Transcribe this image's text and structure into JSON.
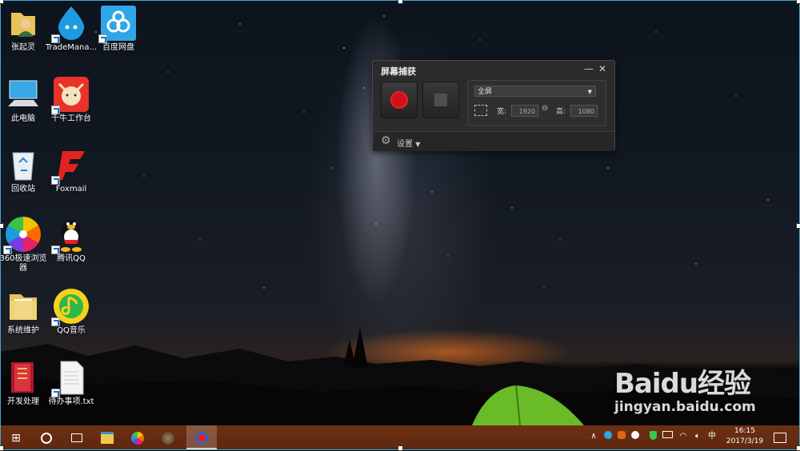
{
  "desktop_icons": [
    {
      "label": "张起灵",
      "icon": "user-folder-icon"
    },
    {
      "label": "TradeMana...",
      "icon": "trademanager-icon"
    },
    {
      "label": "百度网盘",
      "icon": "baidu-netdisk-icon"
    },
    {
      "label": "此电脑",
      "icon": "this-pc-icon"
    },
    {
      "label": "千牛工作台",
      "icon": "qianniu-icon"
    },
    {
      "label": "回收站",
      "icon": "recycle-bin-icon"
    },
    {
      "label": "Foxmail",
      "icon": "foxmail-icon"
    },
    {
      "label": "360极速浏览",
      "label2": "器",
      "icon": "360-browser-icon"
    },
    {
      "label": "腾讯QQ",
      "icon": "qq-icon"
    },
    {
      "label": "系统维护",
      "icon": "folder-icon"
    },
    {
      "label": "QQ音乐",
      "icon": "qq-music-icon"
    },
    {
      "label": "开发处理",
      "icon": "winrar-icon"
    },
    {
      "label": "待办事项.txt",
      "icon": "text-file-icon"
    }
  ],
  "capture_window": {
    "title": "屏幕捕获",
    "mode": "全屏",
    "width_label": "宽:",
    "width_value": "1920",
    "height_label": "高:",
    "height_value": "1080",
    "settings_label": "设置"
  },
  "taskbar": {
    "ime": "中",
    "time": "16:15",
    "date": "2017/3/19"
  },
  "watermark": {
    "brand": "Baidu经验",
    "url": "jingyan.baidu.com"
  },
  "colors": {
    "taskbar": "#6a2c10",
    "record": "#d0101a",
    "selection_border": "#3fa8d6"
  }
}
